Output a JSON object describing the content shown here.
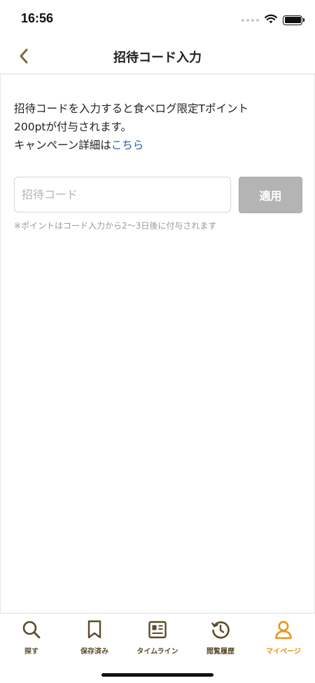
{
  "status_bar": {
    "time": "16:56",
    "icons": [
      "signal-dots-icon",
      "wifi-icon",
      "battery-icon"
    ]
  },
  "header": {
    "title": "招待コード入力",
    "back_icon": "chevron-left-icon"
  },
  "main": {
    "description_line1": "招待コードを入力すると食べログ限定Tポイント",
    "description_line2": "200ptが付与されます。",
    "description_line3_prefix": "キャンペーン詳細は",
    "description_link": "こちら",
    "code_input": {
      "value": "",
      "placeholder": "招待コード"
    },
    "apply_label": "適用",
    "note": "※ポイントはコード入力から2〜3日後に付与されます"
  },
  "tab_bar": {
    "items": [
      {
        "label": "探す",
        "icon": "search-icon",
        "active": false
      },
      {
        "label": "保存済み",
        "icon": "bookmark-icon",
        "active": false
      },
      {
        "label": "タイムライン",
        "icon": "timeline-icon",
        "active": false
      },
      {
        "label": "閲覧履歴",
        "icon": "history-icon",
        "active": false
      },
      {
        "label": "マイページ",
        "icon": "person-icon",
        "active": true
      }
    ]
  },
  "colors": {
    "accent": "#e8951a",
    "tab_inactive": "#5a4a2a",
    "link": "#2b5fb0",
    "button_disabled": "#b4b4b4",
    "back_arrow": "#7a6a3e"
  }
}
